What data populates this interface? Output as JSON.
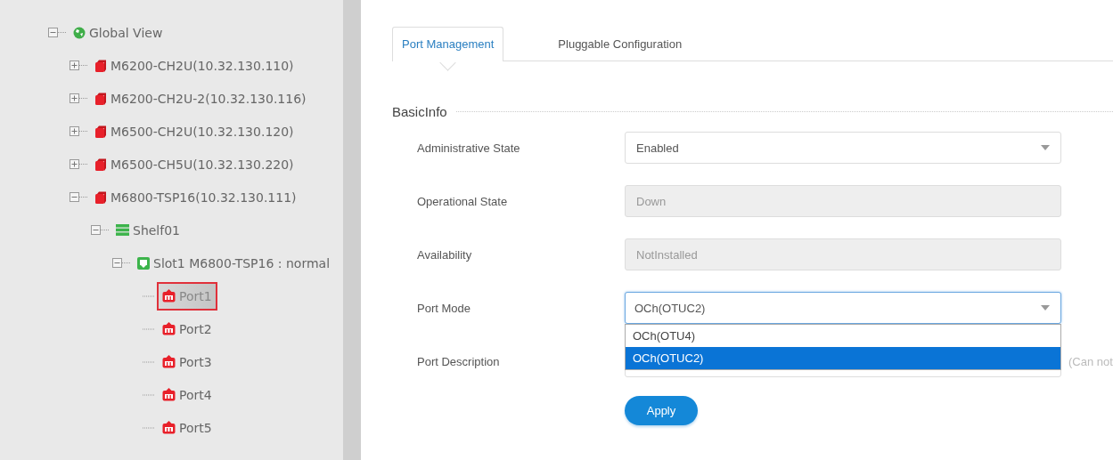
{
  "tree": [
    {
      "kind": "globe",
      "label": "Global View",
      "expanded": true,
      "selected": false,
      "children": [
        {
          "kind": "device",
          "label": "M6200-CH2U(10.32.130.110)",
          "expanded": false,
          "selected": false
        },
        {
          "kind": "device",
          "label": "M6200-CH2U-2(10.32.130.116)",
          "expanded": false,
          "selected": false
        },
        {
          "kind": "device",
          "label": "M6500-CH2U(10.32.130.120)",
          "expanded": false,
          "selected": false
        },
        {
          "kind": "device",
          "label": "M6500-CH5U(10.32.130.220)",
          "expanded": false,
          "selected": false
        },
        {
          "kind": "device",
          "label": "M6800-TSP16(10.32.130.111)",
          "expanded": true,
          "selected": false,
          "children": [
            {
              "kind": "shelf",
              "label": "Shelf01",
              "expanded": true,
              "selected": false,
              "children": [
                {
                  "kind": "slot",
                  "label": "Slot1 M6800-TSP16 : normal",
                  "expanded": true,
                  "selected": false,
                  "children": [
                    {
                      "kind": "port",
                      "label": "Port1",
                      "selected": true
                    },
                    {
                      "kind": "port",
                      "label": "Port2",
                      "selected": false
                    },
                    {
                      "kind": "port",
                      "label": "Port3",
                      "selected": false
                    },
                    {
                      "kind": "port",
                      "label": "Port4",
                      "selected": false
                    },
                    {
                      "kind": "port",
                      "label": "Port5",
                      "selected": false
                    }
                  ]
                }
              ]
            }
          ]
        }
      ]
    }
  ],
  "tabs": [
    {
      "label": "Port Management",
      "selected": true
    },
    {
      "label": "Pluggable Configuration",
      "selected": false
    }
  ],
  "section_title": "BasicInfo",
  "fields": [
    {
      "label": "Administrative State",
      "kind": "select",
      "value": "Enabled",
      "disabled": false
    },
    {
      "label": "Operational State",
      "kind": "text",
      "value": "Down",
      "disabled": true
    },
    {
      "label": "Availability",
      "kind": "text",
      "value": "NotInstalled",
      "disabled": true
    },
    {
      "label": "Port Mode",
      "kind": "select",
      "value": "OCh(OTUC2)",
      "disabled": false,
      "expanded": true,
      "options": [
        {
          "label": "OCh(OTU4)",
          "selected": false
        },
        {
          "label": "OCh(OTUC2)",
          "selected": true
        }
      ]
    },
    {
      "label": "Port Description",
      "kind": "text",
      "disabled": false,
      "hint": "(Can not"
    }
  ],
  "apply_button": "Apply"
}
